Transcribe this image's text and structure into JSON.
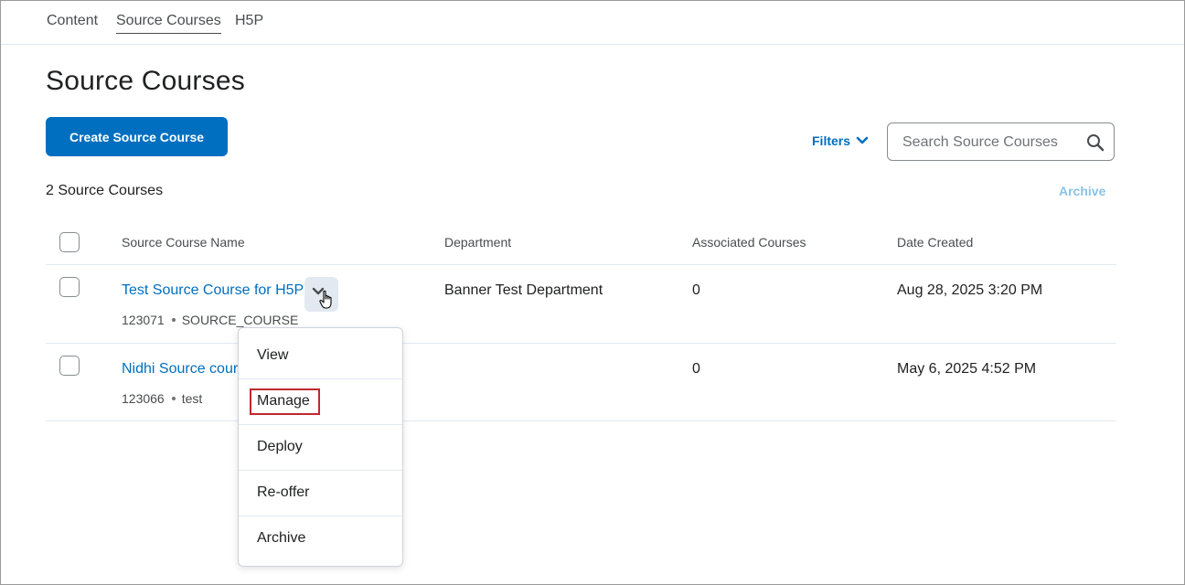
{
  "nav": {
    "tabs": [
      {
        "label": "Content"
      },
      {
        "label": "Source Courses"
      },
      {
        "label": "H5P"
      }
    ]
  },
  "page": {
    "title": "Source Courses",
    "create_label": "Create Source Course",
    "filters_label": "Filters",
    "search_placeholder": "Search Source Courses",
    "count_label": "2 Source Courses",
    "archive_label": "Archive"
  },
  "table": {
    "headers": [
      "Source Course Name",
      "Department",
      "Associated Courses",
      "Date Created"
    ],
    "rows": [
      {
        "name": "Test Source Course for H5P",
        "code": "123071",
        "type": "SOURCE_COURSE",
        "department": "Banner Test Department",
        "associated": "0",
        "date": "Aug 28, 2025 3:20 PM"
      },
      {
        "name": "Nidhi Source cour",
        "code": "123066",
        "type": "test",
        "department": "",
        "associated": "0",
        "date": "May 6, 2025 4:52 PM"
      }
    ]
  },
  "context_menu": {
    "items": [
      {
        "label": "View"
      },
      {
        "label": "Manage"
      },
      {
        "label": "Deploy"
      },
      {
        "label": "Re-offer"
      },
      {
        "label": "Archive"
      }
    ]
  },
  "colors": {
    "accent": "#006fbf",
    "highlight_box": "#c0282d"
  }
}
